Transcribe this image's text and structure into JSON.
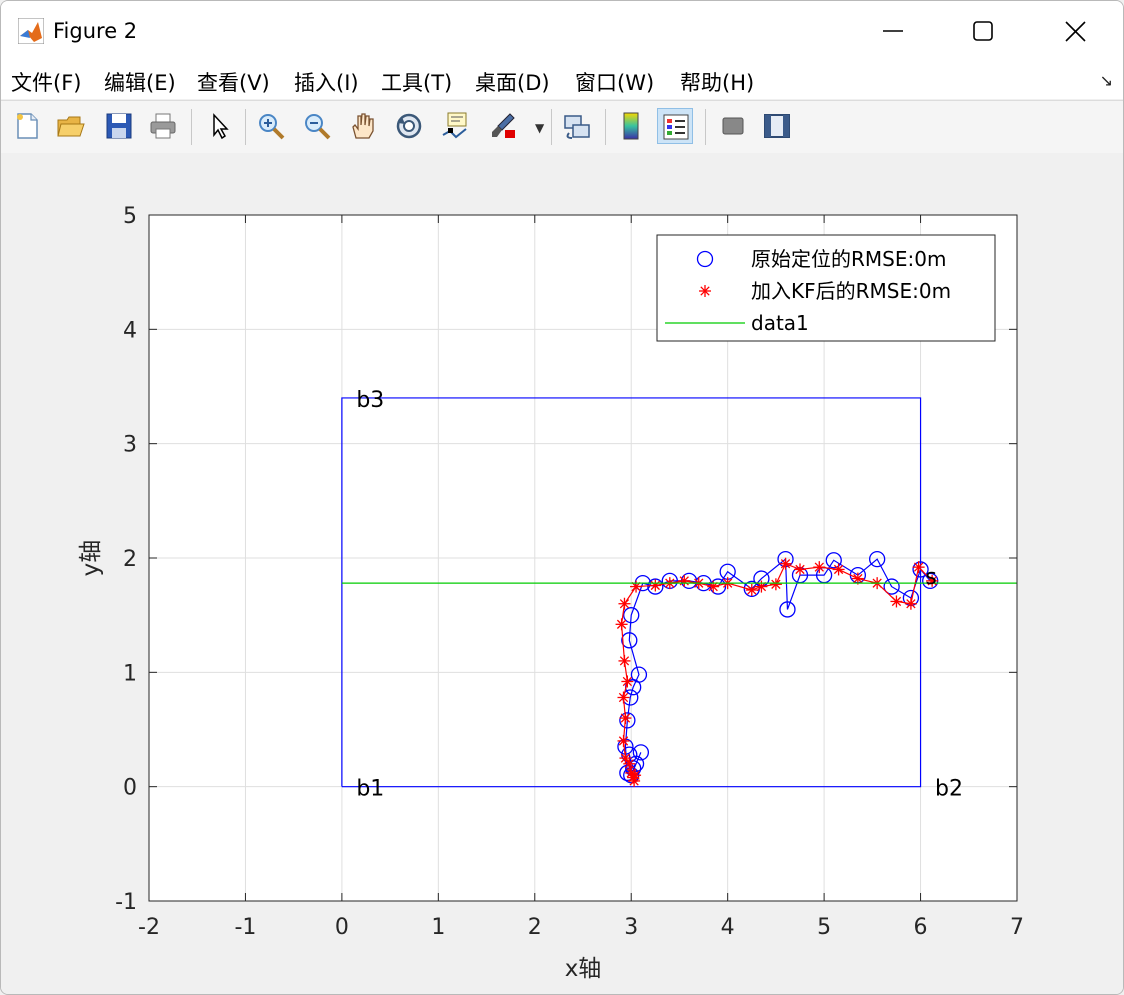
{
  "window": {
    "title": "Figure 2",
    "icon": "matlab-icon",
    "controls": [
      "minimize-icon",
      "maximize-icon",
      "close-icon"
    ]
  },
  "menu": {
    "items": [
      "文件(F)",
      "编辑(E)",
      "查看(V)",
      "插入(I)",
      "工具(T)",
      "桌面(D)",
      "窗口(W)",
      "帮助(H)"
    ],
    "dock_arrow": "↘"
  },
  "toolbar": {
    "buttons": [
      "new-figure-icon",
      "open-file-icon",
      "save-icon",
      "print-icon",
      "select-arrow-icon",
      "zoom-in-icon",
      "zoom-out-icon",
      "pan-hand-icon",
      "rotate-3d-icon",
      "data-cursor-icon",
      "brush-icon",
      "link-plot-icon",
      "colorbar-icon",
      "legend-icon",
      "hide-plot-tools-icon",
      "show-plot-tools-icon"
    ],
    "active": "legend-icon"
  },
  "chart_data": {
    "type": "line",
    "title": "",
    "xlabel": "x轴",
    "ylabel": "y轴",
    "xlim": [
      -2,
      7
    ],
    "ylim": [
      -1,
      5
    ],
    "xticks": [
      "-2",
      "-1",
      "0",
      "1",
      "2",
      "3",
      "4",
      "5",
      "6",
      "7"
    ],
    "yticks": [
      "-1",
      "0",
      "1",
      "2",
      "3",
      "4",
      "5"
    ],
    "grid": true,
    "legend_position": "top-right",
    "legend": [
      "原始定位的RMSE:0m",
      "加入KF后的RMSE:0m",
      "data1"
    ],
    "annotations": [
      {
        "text": "b1",
        "x": 0.15,
        "y": 0.0
      },
      {
        "text": "b2",
        "x": 6.15,
        "y": 0.0
      },
      {
        "text": "b3",
        "x": 0.15,
        "y": 3.4
      },
      {
        "text": "s",
        "x": 6.05,
        "y": 1.85
      }
    ],
    "series": [
      {
        "name": "",
        "color": "#0000ff",
        "style": "line",
        "x": [
          0,
          6,
          6,
          0,
          0
        ],
        "y": [
          0,
          0,
          3.4,
          3.4,
          0
        ]
      },
      {
        "name": "原始定位的RMSE:0m",
        "color": "#0000ff",
        "style": "circle-line",
        "x": [
          6.1,
          6.0,
          5.9,
          5.7,
          5.55,
          5.35,
          5.1,
          5.0,
          4.75,
          4.62,
          4.6,
          4.35,
          4.25,
          4.0,
          3.9,
          3.75,
          3.6,
          3.4,
          3.25,
          3.12,
          3.0,
          2.98,
          3.08,
          3.02,
          2.99,
          2.96,
          2.94,
          2.96,
          3.05,
          3.1,
          3.0,
          2.98,
          3.02
        ],
        "y": [
          1.8,
          1.9,
          1.65,
          1.75,
          1.99,
          1.85,
          1.98,
          1.85,
          1.85,
          1.55,
          1.99,
          1.82,
          1.73,
          1.88,
          1.75,
          1.78,
          1.8,
          1.8,
          1.75,
          1.78,
          1.5,
          1.28,
          0.98,
          0.87,
          0.78,
          0.58,
          0.35,
          0.12,
          0.2,
          0.3,
          0.1,
          0.28,
          0.16
        ]
      },
      {
        "name": "加入KF后的RMSE:0m",
        "color": "#ff0000",
        "style": "star-line",
        "x": [
          6.12,
          5.98,
          5.9,
          5.75,
          5.55,
          5.35,
          5.15,
          4.95,
          4.75,
          4.6,
          4.5,
          4.35,
          4.25,
          4.0,
          3.85,
          3.7,
          3.55,
          3.4,
          3.25,
          3.05,
          2.93,
          2.9,
          2.93,
          2.96,
          2.92,
          2.94,
          2.92,
          2.94,
          2.98,
          3.0,
          3.02,
          3.03,
          3.04
        ],
        "y": [
          1.8,
          1.92,
          1.6,
          1.62,
          1.78,
          1.82,
          1.9,
          1.92,
          1.9,
          1.95,
          1.77,
          1.75,
          1.72,
          1.78,
          1.75,
          1.78,
          1.8,
          1.78,
          1.76,
          1.75,
          1.6,
          1.42,
          1.1,
          0.92,
          0.78,
          0.6,
          0.4,
          0.25,
          0.2,
          0.12,
          0.08,
          0.05,
          0.1
        ]
      },
      {
        "name": "data1",
        "color": "#00cc00",
        "style": "line",
        "x": [
          0,
          7
        ],
        "y": [
          1.78,
          1.78
        ]
      }
    ]
  }
}
